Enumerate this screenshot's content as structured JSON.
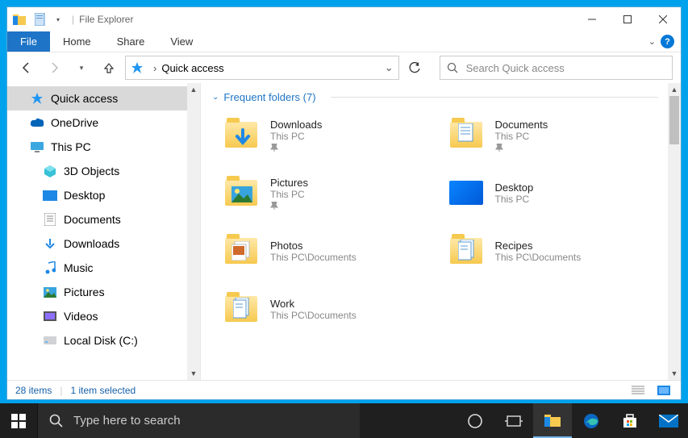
{
  "window": {
    "title": "File Explorer",
    "controls": {
      "minimize": "—",
      "maximize": "☐",
      "close": "✕"
    }
  },
  "ribbon": {
    "file": "File",
    "tabs": [
      "Home",
      "Share",
      "View"
    ]
  },
  "address": {
    "location": "Quick access"
  },
  "search": {
    "placeholder": "Search Quick access"
  },
  "sidebar": {
    "items": [
      {
        "label": "Quick access",
        "icon": "pin",
        "selected": true
      },
      {
        "label": "OneDrive",
        "icon": "cloud"
      },
      {
        "label": "This PC",
        "icon": "pc"
      },
      {
        "label": "3D Objects",
        "icon": "3d",
        "child": true
      },
      {
        "label": "Desktop",
        "icon": "desktop",
        "child": true
      },
      {
        "label": "Documents",
        "icon": "doc",
        "child": true
      },
      {
        "label": "Downloads",
        "icon": "down",
        "child": true
      },
      {
        "label": "Music",
        "icon": "music",
        "child": true
      },
      {
        "label": "Pictures",
        "icon": "pic",
        "child": true
      },
      {
        "label": "Videos",
        "icon": "video",
        "child": true
      },
      {
        "label": "Local Disk (C:)",
        "icon": "disk",
        "child": true
      }
    ]
  },
  "main": {
    "section_title": "Frequent folders (7)",
    "folders": [
      {
        "name": "Downloads",
        "location": "This PC",
        "pinned": true,
        "icon": "downloads"
      },
      {
        "name": "Documents",
        "location": "This PC",
        "pinned": true,
        "icon": "documents"
      },
      {
        "name": "Pictures",
        "location": "This PC",
        "pinned": true,
        "icon": "pictures"
      },
      {
        "name": "Desktop",
        "location": "This PC",
        "pinned": false,
        "icon": "desktop"
      },
      {
        "name": "Photos",
        "location": "This PC\\Documents",
        "pinned": false,
        "icon": "photos"
      },
      {
        "name": "Recipes",
        "location": "This PC\\Documents",
        "pinned": false,
        "icon": "docs-folder"
      },
      {
        "name": "Work",
        "location": "This PC\\Documents",
        "pinned": false,
        "icon": "docs-folder"
      }
    ]
  },
  "status": {
    "count": "28 items",
    "selection": "1 item selected"
  },
  "taskbar": {
    "search_placeholder": "Type here to search"
  }
}
